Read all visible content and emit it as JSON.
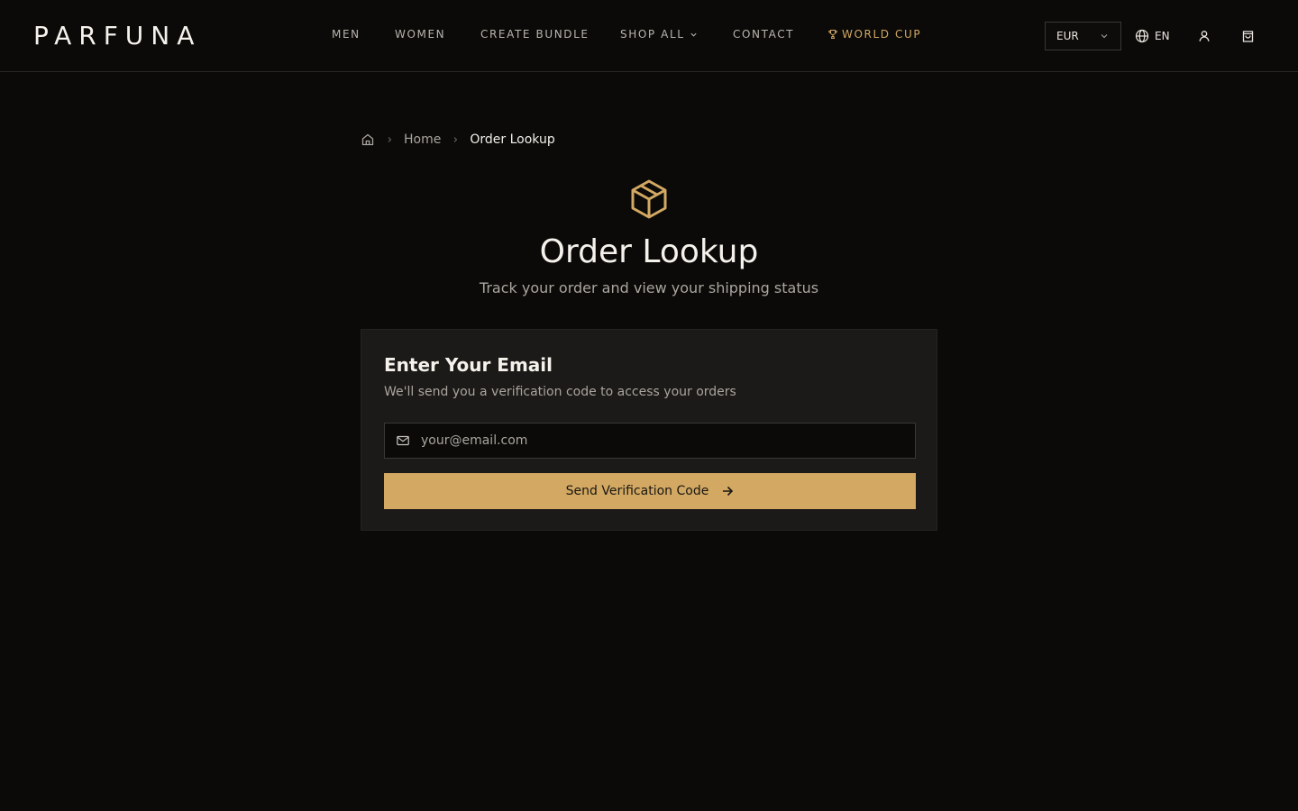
{
  "brand": {
    "logo": "PARFUNA"
  },
  "nav": {
    "items": [
      {
        "label": "MEN"
      },
      {
        "label": "WOMEN"
      },
      {
        "label": "CREATE BUNDLE"
      },
      {
        "label": "SHOP ALL"
      },
      {
        "label": "CONTACT"
      },
      {
        "label": "WORLD CUP"
      }
    ]
  },
  "header": {
    "currency": "EUR",
    "language": "EN"
  },
  "breadcrumb": {
    "home": "Home",
    "current": "Order Lookup"
  },
  "hero": {
    "title": "Order Lookup",
    "subtitle": "Track your order and view your shipping status"
  },
  "card": {
    "title": "Enter Your Email",
    "description": "We'll send you a verification code to access your orders",
    "email_placeholder": "your@email.com",
    "email_value": "",
    "button_label": "Send Verification Code"
  },
  "colors": {
    "background": "#0b0a09",
    "accent": "#d2a862",
    "card": "#1c1a18"
  }
}
